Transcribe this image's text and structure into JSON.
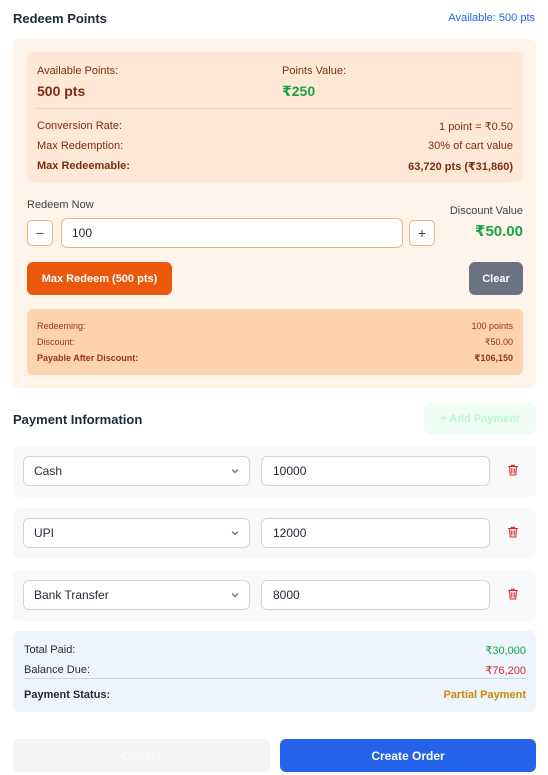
{
  "redeem": {
    "title": "Redeem Points",
    "available_link": "Available: 500 pts",
    "available_points_label": "Available Points:",
    "available_points_value": "500 pts",
    "points_value_label": "Points Value:",
    "points_value_value": "₹250",
    "conversion_label": "Conversion Rate:",
    "conversion_value": "1 point = ₹0.50",
    "max_redemption_label": "Max Redemption:",
    "max_redemption_value": "30% of cart value",
    "max_redeemable_label": "Max Redeemable:",
    "max_redeemable_value": "63,720 pts (₹31,860)",
    "redeem_now_label": "Redeem Now",
    "minus_label": "−",
    "plus_label": "+",
    "input_value": "100",
    "discount_label": "Discount Value",
    "discount_value": "₹50.00",
    "max_button": "Max Redeem (500 pts)",
    "clear_button": "Clear",
    "calc": {
      "redeeming_label": "Redeeming:",
      "redeeming_value": "100 points",
      "discount_label": "Discount:",
      "discount_value": "₹50.00",
      "payable_label": "Payable After Discount:",
      "payable_value": "₹106,150"
    }
  },
  "payment": {
    "title": "Payment Information",
    "add_button": "+ Add Payment",
    "rows": [
      {
        "method": "Cash",
        "amount": "10000"
      },
      {
        "method": "UPI",
        "amount": "12000"
      },
      {
        "method": "Bank Transfer",
        "amount": "8000"
      }
    ],
    "total_paid_label": "Total Paid:",
    "total_paid_value": "₹30,000",
    "balance_due_label": "Balance Due:",
    "balance_due_value": "₹76,200",
    "status_label": "Payment Status:",
    "status_value": "Partial Payment"
  },
  "footer": {
    "cancel_button": "Cancel",
    "create_button": "Create Order"
  },
  "colors": {
    "accent_orange": "#ea580c",
    "accent_blue": "#2563eb",
    "success_green": "#16a34a",
    "danger_red": "#dc2626",
    "warning_amber": "#ca8a04"
  },
  "icons": {
    "chevron": "chevron-down-icon",
    "trash": "trash-icon"
  }
}
